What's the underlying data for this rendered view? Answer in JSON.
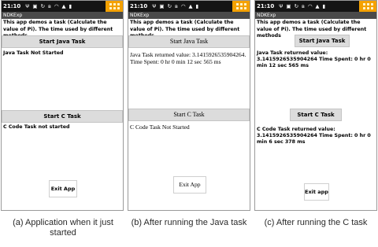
{
  "status_bar": {
    "time": "21:10",
    "icons": [
      "usb-icon",
      "notification-icon",
      "sync-icon",
      "bluetooth-icon",
      "wifi-icon",
      "signal-icon",
      "battery-icon"
    ]
  },
  "app_title": "NDKExp",
  "description": "This app demos a task (Calculate the value of Pi). The time used by different methods",
  "screens": [
    {
      "java_button": "Start Java Task",
      "java_status": "Java Task Not Started",
      "c_button": "Start C Task",
      "c_status": "C Code Task not started",
      "exit_button": "Exit App",
      "caption": "(a) Application when it just started"
    },
    {
      "java_button": "Start Java Task",
      "java_status": "Java Task returned value: 3.1415926535904264. Time Spent: 0 hr 0 min 12 sec 565 ms",
      "c_button": "Start C Task",
      "c_status": "C Code Task Not Started",
      "exit_button": "Exit App",
      "caption": "(b) After running the Java task"
    },
    {
      "java_button": "Start Java Task",
      "java_status": "Java Task returned value: 3.1415926535904264 Time Spent: 0 hr 0 min 12 sec 565 ms",
      "c_button": "Start C Task",
      "c_status": "C Code Task returned value: 3.1415926535904264 Time Spent: 0 hr 0 min 6 sec 378 ms",
      "exit_button": "Exit app",
      "caption": "(c) After running the C task"
    }
  ],
  "colors": {
    "status_bar": "#141414",
    "title_bar": "#4a4a4a",
    "menu_button": "#f4a100",
    "button_bg": "#dcdcdc"
  }
}
